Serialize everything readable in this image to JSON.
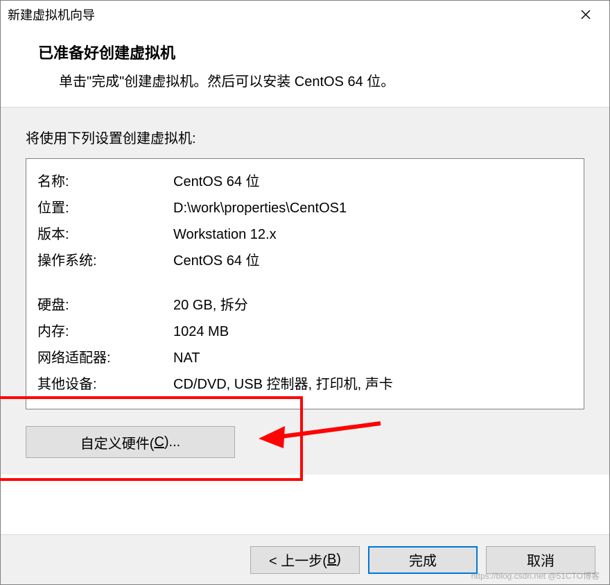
{
  "window": {
    "title": "新建虚拟机向导"
  },
  "header": {
    "heading": "已准备好创建虚拟机",
    "subheading": "单击\"完成\"创建虚拟机。然后可以安装 CentOS 64 位。"
  },
  "intro": "将使用下列设置创建虚拟机:",
  "settings": {
    "name_label": "名称:",
    "name_value": "CentOS 64 位",
    "location_label": "位置:",
    "location_value": "D:\\work\\properties\\CentOS1",
    "version_label": "版本:",
    "version_value": "Workstation 12.x",
    "os_label": "操作系统:",
    "os_value": "CentOS 64 位",
    "disk_label": "硬盘:",
    "disk_value": "20 GB, 拆分",
    "memory_label": "内存:",
    "memory_value": "1024 MB",
    "network_label": "网络适配器:",
    "network_value": "NAT",
    "other_label": "其他设备:",
    "other_value": "CD/DVD, USB 控制器, 打印机, 声卡"
  },
  "buttons": {
    "customize_prefix": "自定义硬件(",
    "customize_key": "C",
    "customize_suffix": ")...",
    "back_prefix": "< 上一步(",
    "back_key": "B",
    "back_suffix": ")",
    "finish": "完成",
    "cancel": "取消"
  },
  "watermark": "https://blog.csdn.net @51CTO博客"
}
